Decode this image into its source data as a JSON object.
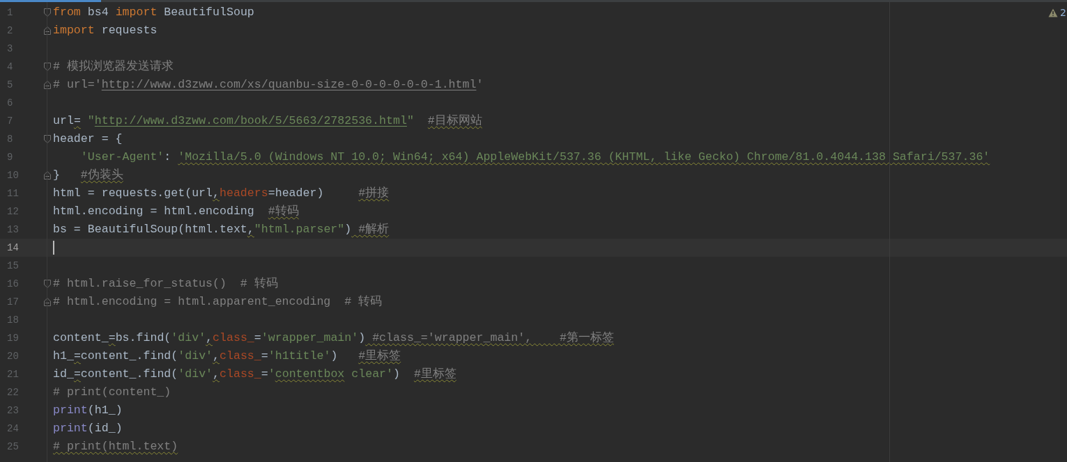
{
  "warnings": {
    "count": "2"
  },
  "lines": [
    {
      "number": "1",
      "fold": {
        "kind": "start"
      },
      "current": false,
      "tokens": [
        {
          "kind": "keyword",
          "text": "from"
        },
        {
          "kind": "plain",
          "text": " bs4 "
        },
        {
          "kind": "keyword",
          "text": "import"
        },
        {
          "kind": "plain",
          "text": " BeautifulSoup"
        }
      ]
    },
    {
      "number": "2",
      "fold": {
        "kind": "end"
      },
      "current": false,
      "tokens": [
        {
          "kind": "keyword",
          "text": "import"
        },
        {
          "kind": "plain",
          "text": " requests"
        }
      ]
    },
    {
      "number": "3",
      "current": false
    },
    {
      "number": "4",
      "fold": {
        "kind": "start"
      },
      "current": false,
      "tokens": [
        {
          "kind": "comment",
          "text": "# 模拟浏览器发送请求"
        }
      ]
    },
    {
      "number": "5",
      "fold": {
        "kind": "end"
      },
      "current": false,
      "tokens": [
        {
          "kind": "comment",
          "text": "# url='"
        },
        {
          "kind": "comment-link",
          "text": "http://www.d3zww.com/xs/quanbu-size-0-0-0-0-0-0-1.html"
        },
        {
          "kind": "comment",
          "text": "'"
        }
      ]
    },
    {
      "number": "6",
      "current": false
    },
    {
      "number": "7",
      "current": false,
      "tokens": [
        {
          "kind": "plain",
          "text": "url"
        },
        {
          "kind": "plain",
          "text": "=",
          "squiggle": true
        },
        {
          "kind": "string",
          "text": " \""
        },
        {
          "kind": "link",
          "text": "http://www.d3zww.com/book/5/5663/2782536.html"
        },
        {
          "kind": "string",
          "text": "\"  "
        },
        {
          "kind": "comment",
          "text": "#目标网站",
          "squiggle": true
        }
      ]
    },
    {
      "number": "8",
      "fold": {
        "kind": "start"
      },
      "current": false,
      "tokens": [
        {
          "kind": "plain",
          "text": "header = {"
        }
      ]
    },
    {
      "number": "9",
      "current": false,
      "tokens": [
        {
          "kind": "string",
          "text": "    'User-Agent'"
        },
        {
          "kind": "plain",
          "text": ": "
        },
        {
          "kind": "string",
          "text": "'Mozilla/5.0 (Windows NT 10.0; Win64; x64) AppleWebKit/537.36 (KHTML, like Gecko) Chrome/81.0.4044.138 Safari/537.36'",
          "squiggle": true
        }
      ]
    },
    {
      "number": "10",
      "fold": {
        "kind": "end"
      },
      "current": false,
      "tokens": [
        {
          "kind": "plain",
          "text": "}   "
        },
        {
          "kind": "comment",
          "text": "#伪装头",
          "squiggle": true
        }
      ]
    },
    {
      "number": "11",
      "current": false,
      "tokens": [
        {
          "kind": "plain",
          "text": "html = requests.get(url"
        },
        {
          "kind": "plain",
          "text": ",",
          "squiggle": true
        },
        {
          "kind": "param",
          "text": "headers"
        },
        {
          "kind": "plain",
          "text": "=header)     "
        },
        {
          "kind": "comment",
          "text": "#拼接",
          "squiggle": true
        }
      ]
    },
    {
      "number": "12",
      "current": false,
      "tokens": [
        {
          "kind": "plain",
          "text": "html.encoding = html.encoding  "
        },
        {
          "kind": "comment",
          "text": "#转码",
          "squiggle": true
        }
      ]
    },
    {
      "number": "13",
      "current": false,
      "tokens": [
        {
          "kind": "plain",
          "text": "bs = BeautifulSoup(html.text"
        },
        {
          "kind": "plain",
          "text": ",",
          "squiggle": true
        },
        {
          "kind": "string",
          "text": "\"html.parser\""
        },
        {
          "kind": "plain",
          "text": ")"
        },
        {
          "kind": "comment",
          "text": " #解析",
          "squiggle": true
        }
      ]
    },
    {
      "number": "14",
      "current": true
    },
    {
      "number": "15",
      "current": false
    },
    {
      "number": "16",
      "fold": {
        "kind": "start"
      },
      "current": false,
      "tokens": [
        {
          "kind": "comment",
          "text": "# html.raise_for_status()  # 转码"
        }
      ]
    },
    {
      "number": "17",
      "fold": {
        "kind": "end"
      },
      "current": false,
      "tokens": [
        {
          "kind": "comment",
          "text": "# html.encoding = html.apparent_encoding  # 转码"
        }
      ]
    },
    {
      "number": "18",
      "current": false
    },
    {
      "number": "19",
      "current": false,
      "tokens": [
        {
          "kind": "plain",
          "text": "content_"
        },
        {
          "kind": "plain",
          "text": "=",
          "squiggle": true
        },
        {
          "kind": "plain",
          "text": "bs.find("
        },
        {
          "kind": "string",
          "text": "'div'"
        },
        {
          "kind": "plain",
          "text": ",",
          "squiggle": true
        },
        {
          "kind": "param",
          "text": "class_"
        },
        {
          "kind": "plain",
          "text": "="
        },
        {
          "kind": "string",
          "text": "'wrapper_main'"
        },
        {
          "kind": "plain",
          "text": ")"
        },
        {
          "kind": "comment",
          "text": " #class_='wrapper_main',    #第一标签",
          "squiggle": true
        }
      ]
    },
    {
      "number": "20",
      "current": false,
      "tokens": [
        {
          "kind": "plain",
          "text": "h1_"
        },
        {
          "kind": "plain",
          "text": "=",
          "squiggle": true
        },
        {
          "kind": "plain",
          "text": "content_.find("
        },
        {
          "kind": "string",
          "text": "'div'"
        },
        {
          "kind": "plain",
          "text": ",",
          "squiggle": true
        },
        {
          "kind": "param",
          "text": "class_"
        },
        {
          "kind": "plain",
          "text": "="
        },
        {
          "kind": "string",
          "text": "'h1title'"
        },
        {
          "kind": "plain",
          "text": ")   "
        },
        {
          "kind": "comment",
          "text": "#里标签",
          "squiggle": true
        }
      ]
    },
    {
      "number": "21",
      "current": false,
      "tokens": [
        {
          "kind": "plain",
          "text": "id_"
        },
        {
          "kind": "plain",
          "text": "=",
          "squiggle": true
        },
        {
          "kind": "plain",
          "text": "content_.find("
        },
        {
          "kind": "string",
          "text": "'div'"
        },
        {
          "kind": "plain",
          "text": ",",
          "squiggle": true
        },
        {
          "kind": "param",
          "text": "class_"
        },
        {
          "kind": "plain",
          "text": "="
        },
        {
          "kind": "string",
          "text": "'"
        },
        {
          "kind": "string",
          "text": "contentbox",
          "squiggle": true
        },
        {
          "kind": "string",
          "text": " clear'"
        },
        {
          "kind": "plain",
          "text": ")  "
        },
        {
          "kind": "comment",
          "text": "#里标签",
          "squiggle": true
        }
      ]
    },
    {
      "number": "22",
      "current": false,
      "tokens": [
        {
          "kind": "comment",
          "text": "# print(content_)"
        }
      ]
    },
    {
      "number": "23",
      "current": false,
      "tokens": [
        {
          "kind": "builtin",
          "text": "print"
        },
        {
          "kind": "plain",
          "text": "(h1_)"
        }
      ]
    },
    {
      "number": "24",
      "current": false,
      "tokens": [
        {
          "kind": "builtin",
          "text": "print"
        },
        {
          "kind": "plain",
          "text": "(id_)"
        }
      ]
    },
    {
      "number": "25",
      "current": false,
      "tokens": [
        {
          "kind": "comment",
          "text": "# print(html.text)",
          "squiggle": true
        }
      ]
    }
  ]
}
